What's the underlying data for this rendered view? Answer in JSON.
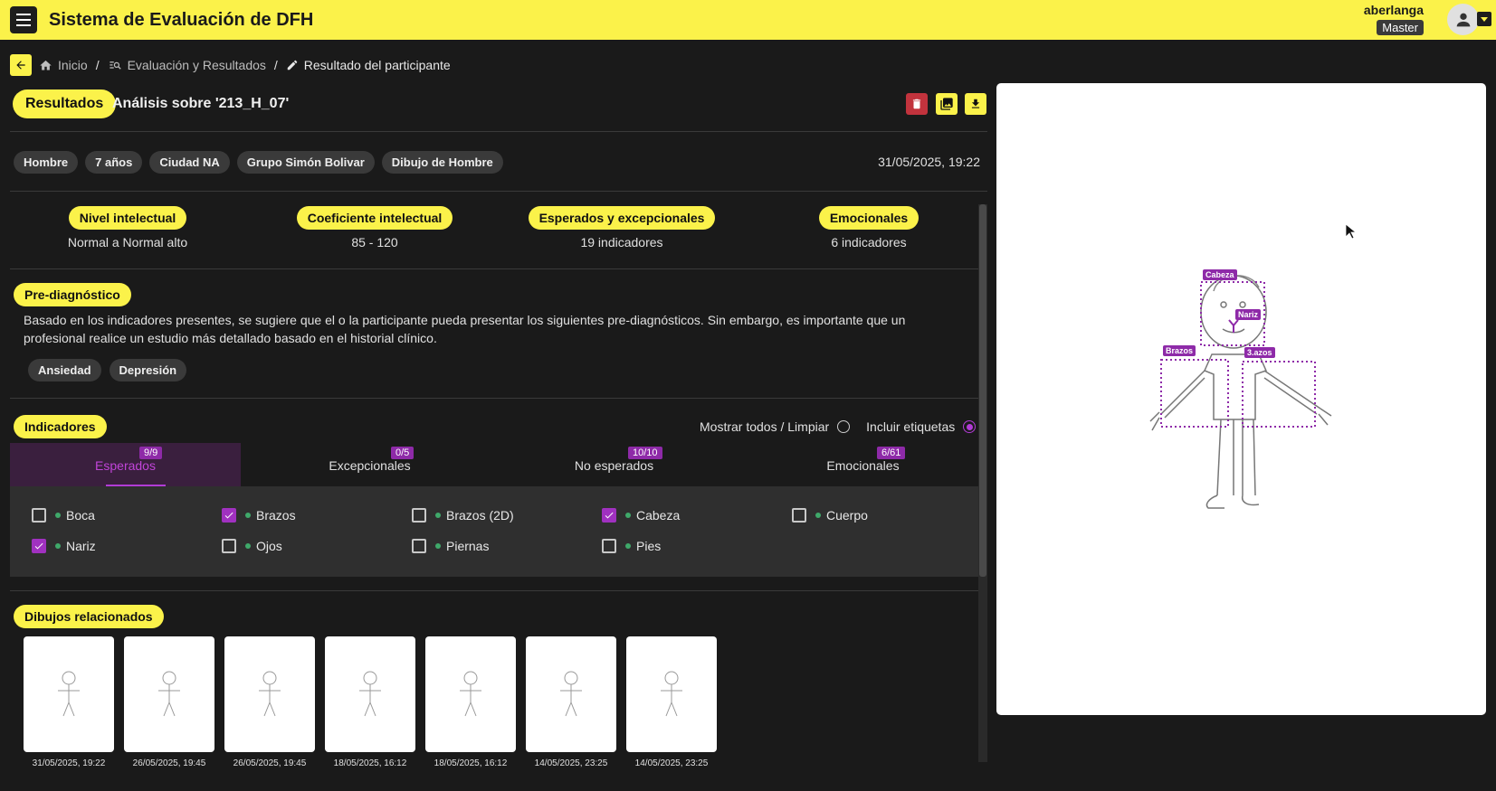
{
  "app": {
    "title": "Sistema de Evaluación de DFH"
  },
  "user": {
    "name": "aberlanga",
    "role": "Master"
  },
  "breadcrumb": {
    "items": [
      "Inicio",
      "Evaluación y Resultados",
      "Resultado del participante"
    ],
    "separator": "/"
  },
  "result": {
    "badge": "Resultados",
    "title": "Análisis sobre '213_H_07'",
    "chips": [
      "Hombre",
      "7 años",
      "Ciudad NA",
      "Grupo Simón Bolivar",
      "Dibujo de Hombre"
    ],
    "date": "31/05/2025, 19:22"
  },
  "stats": [
    {
      "label": "Nivel intelectual",
      "value": "Normal a Normal alto"
    },
    {
      "label": "Coeficiente intelectual",
      "value": "85 - 120"
    },
    {
      "label": "Esperados y excepcionales",
      "value": "19 indicadores"
    },
    {
      "label": "Emocionales",
      "value": "6 indicadores"
    }
  ],
  "prediagnosis": {
    "label": "Pre-diagnóstico",
    "text": "Basado en los indicadores presentes, se sugiere que el o la participante pueda presentar los siguientes pre-diagnósticos. Sin embargo, es importante que un profesional realice un estudio más detallado basado en el historial clínico.",
    "tags": [
      "Ansiedad",
      "Depresión"
    ]
  },
  "indicators": {
    "label": "Indicadores",
    "toggle_show_all": "Mostrar todos / Limpiar",
    "toggle_labels": "Incluir etiquetas",
    "tabs": [
      {
        "label": "Esperados",
        "count": "9/9"
      },
      {
        "label": "Excepcionales",
        "count": "0/5"
      },
      {
        "label": "No esperados",
        "count": "10/10"
      },
      {
        "label": "Emocionales",
        "count": "6/61"
      }
    ],
    "items": [
      {
        "label": "Boca",
        "checked": false
      },
      {
        "label": "Brazos",
        "checked": true
      },
      {
        "label": "Brazos (2D)",
        "checked": false
      },
      {
        "label": "Cabeza",
        "checked": true
      },
      {
        "label": "Cuerpo",
        "checked": false
      },
      {
        "label": "Nariz",
        "checked": true
      },
      {
        "label": "Ojos",
        "checked": false
      },
      {
        "label": "Piernas",
        "checked": false
      },
      {
        "label": "Pies",
        "checked": false
      }
    ]
  },
  "related": {
    "label": "Dibujos relacionados",
    "items": [
      {
        "date": "31/05/2025, 19:22"
      },
      {
        "date": "26/05/2025, 19:45"
      },
      {
        "date": "26/05/2025, 19:45"
      },
      {
        "date": "18/05/2025, 16:12"
      },
      {
        "date": "18/05/2025, 16:12"
      },
      {
        "date": "14/05/2025, 23:25"
      },
      {
        "date": "14/05/2025, 23:25"
      }
    ]
  },
  "drawing": {
    "tags": {
      "head": "Cabeza",
      "nose": "Nariz",
      "arms_left": "Brazos",
      "arms_right": "3.azos"
    }
  },
  "colors": {
    "accent": "#fbf24a",
    "purple": "#8e2aa8",
    "background": "#1a1a1a",
    "danger": "#c2333d"
  }
}
